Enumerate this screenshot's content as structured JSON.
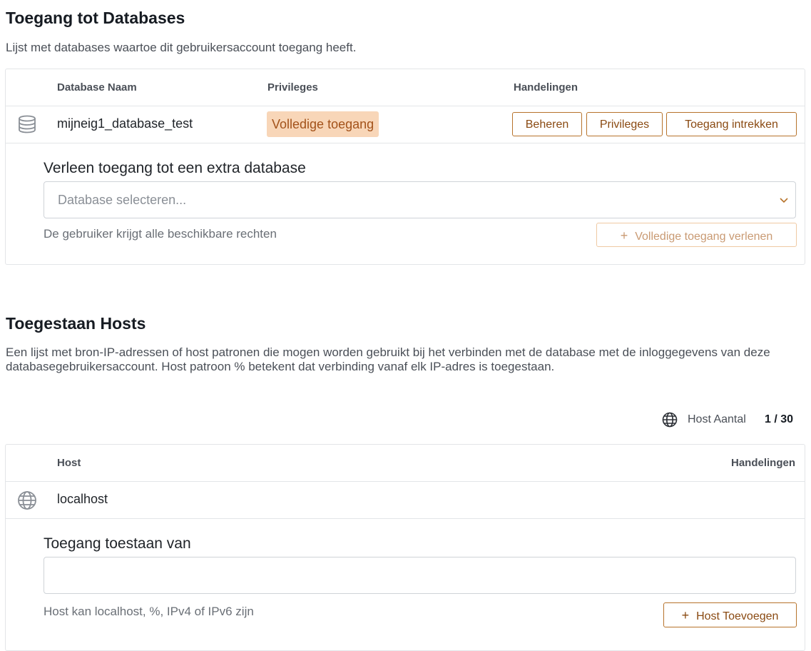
{
  "databases": {
    "title": "Toegang tot Databases",
    "description": "Lijst met databases waartoe dit gebruikersaccount toegang heeft.",
    "columns": {
      "name": "Database Naam",
      "privileges": "Privileges",
      "actions": "Handelingen"
    },
    "rows": [
      {
        "icon": "database-icon",
        "name": "mijneig1_database_test",
        "privilege_badge": "Volledige toegang",
        "actions": {
          "manage": "Beheren",
          "privileges": "Privileges",
          "revoke": "Toegang intrekken"
        }
      }
    ],
    "grant": {
      "label": "Verleen toegang tot een extra database",
      "placeholder": "Database selecteren...",
      "help": "De gebruiker krijgt alle beschikbare rechten",
      "button": "Volledige toegang verlenen",
      "button_icon": "plus-icon",
      "button_disabled": true
    }
  },
  "hosts": {
    "title": "Toegestaan Hosts",
    "description": "Een lijst met bron-IP-adressen of host patronen die mogen worden gebruikt bij het verbinden met de database met de inloggegevens van deze databasegebruikersaccount. Host patroon % betekent dat verbinding vanaf elk IP-adres is toegestaan.",
    "count_label": "Host Aantal",
    "count_value": "1 / 30",
    "count_icon": "globe-icon",
    "columns": {
      "host": "Host",
      "actions": "Handelingen"
    },
    "rows": [
      {
        "icon": "globe-icon",
        "host": "localhost"
      }
    ],
    "add": {
      "label": "Toegang toestaan van",
      "value": "",
      "help": "Host kan localhost, %, IPv4 of IPv6 zijn",
      "button": "Host Toevoegen",
      "button_icon": "plus-icon"
    }
  },
  "colors": {
    "accent": "#b7732b",
    "badge_bg": "#f8d6b8",
    "badge_text": "#a3521a"
  }
}
